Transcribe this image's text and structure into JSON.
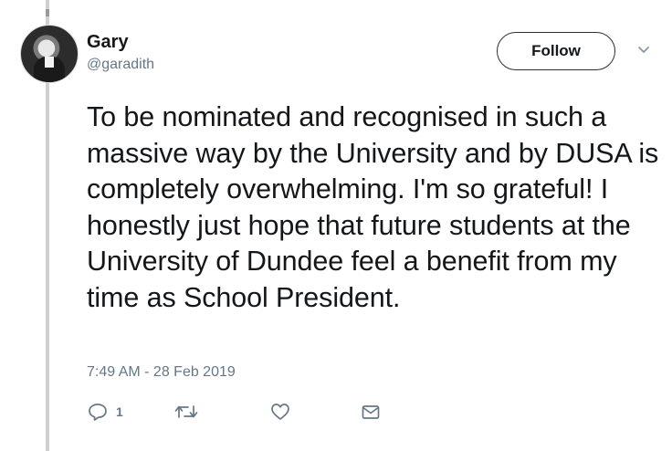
{
  "tweet": {
    "author_name": "Gary",
    "author_handle": "@garadith",
    "follow_label": "Follow",
    "text": "To be nominated and recognised in such a massive way by the University and by DUSA is completely overwhelming. I'm so grateful! I honestly just hope that future students at the University of Dundee feel a benefit from my time as School President.",
    "timestamp": "7:49 AM - 28 Feb 2019",
    "reply_count": "1"
  },
  "icons": {
    "reply": "reply-icon",
    "retweet": "retweet-icon",
    "like": "heart-icon",
    "dm": "envelope-icon",
    "more": "chevron-down-icon"
  },
  "colors": {
    "text": "#14171a",
    "secondary": "#657786",
    "thread_line": "#cfcfcf"
  }
}
